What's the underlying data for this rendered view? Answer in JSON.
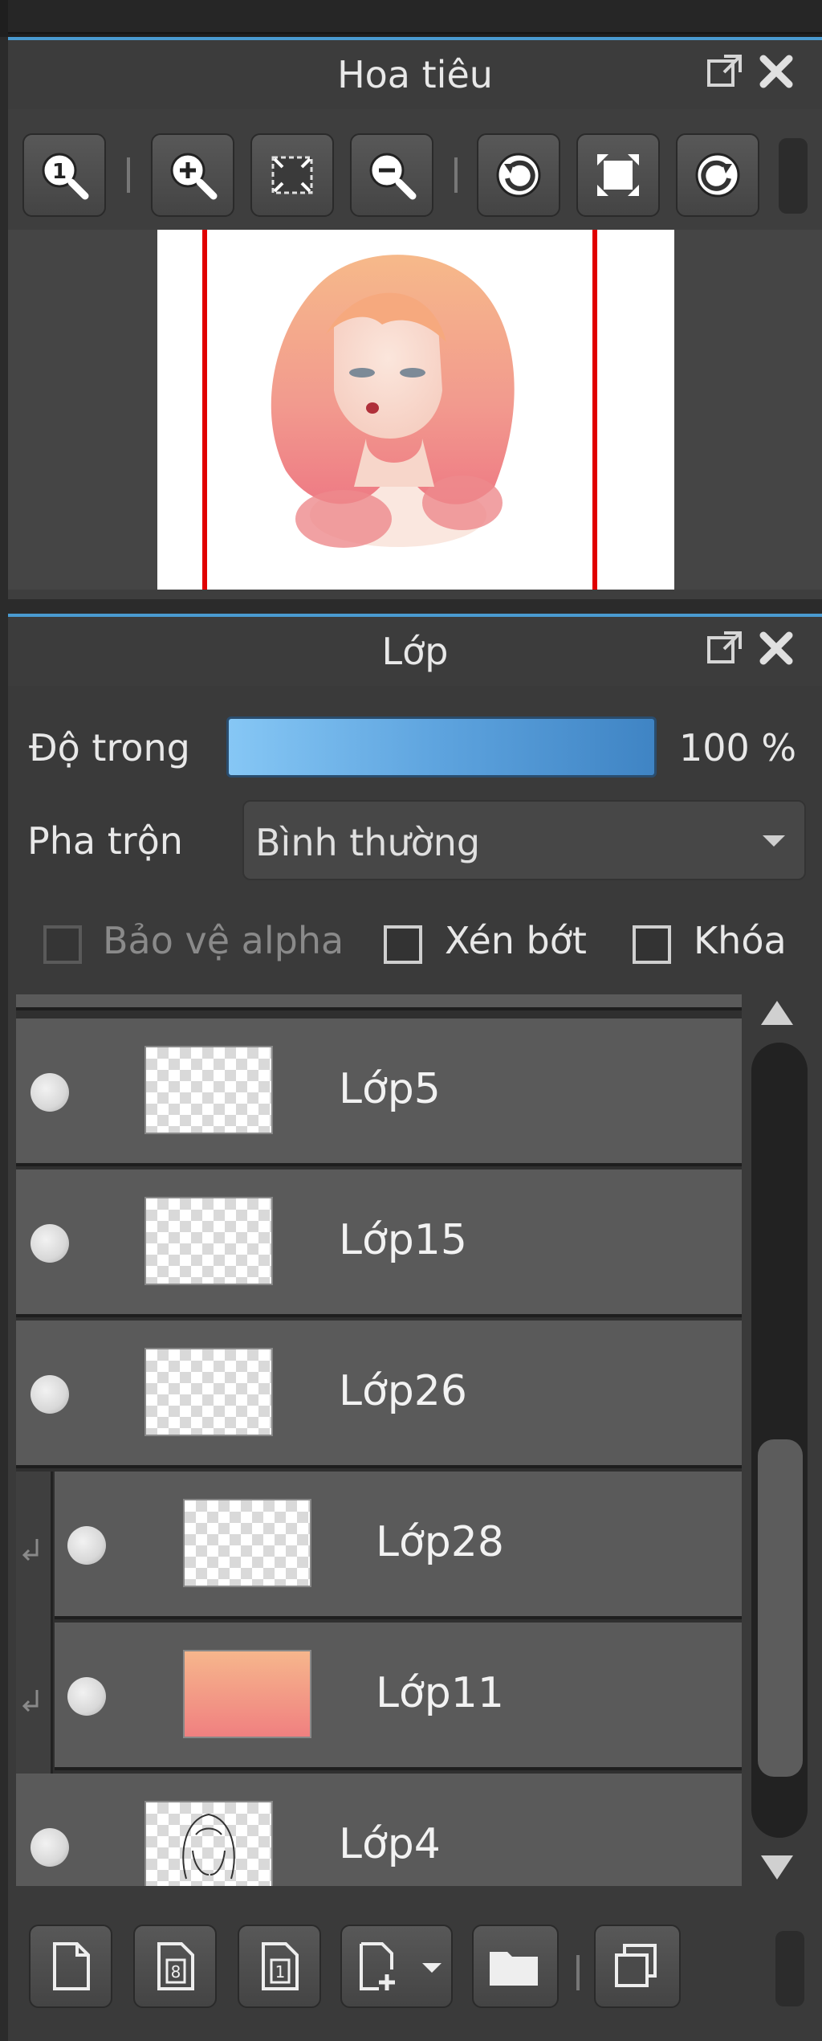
{
  "navigator": {
    "title": "Hoa tiêu",
    "tools": [
      {
        "icon": "actual-size-icon"
      },
      {
        "icon": "zoom-in-icon"
      },
      {
        "icon": "fit-screen-icon"
      },
      {
        "icon": "zoom-out-icon"
      },
      {
        "icon": "rotate-left-icon"
      },
      {
        "icon": "reset-view-icon"
      },
      {
        "icon": "rotate-right-icon"
      }
    ]
  },
  "layers_panel": {
    "title": "Lớp",
    "opacity_label": "Độ trong",
    "opacity_value": "100 %",
    "opacity_fraction": 1.0,
    "blend_label": "Pha trộn",
    "blend_value": "Bình thường",
    "protect_alpha": "Bảo vệ alpha",
    "clipping": "Xén bớt",
    "lock": "Khóa",
    "layers": [
      {
        "name": "Lớp5",
        "clipped": false,
        "thumb": "transparent"
      },
      {
        "name": "Lớp15",
        "clipped": false,
        "thumb": "transparent"
      },
      {
        "name": "Lớp26",
        "clipped": false,
        "thumb": "transparent"
      },
      {
        "name": "Lớp28",
        "clipped": true,
        "thumb": "transparent"
      },
      {
        "name": "Lớp11",
        "clipped": true,
        "thumb": "gradient"
      },
      {
        "name": "Lớp4",
        "clipped": false,
        "thumb": "sketch"
      }
    ],
    "bottom_tools": [
      {
        "icon": "new-layer-icon"
      },
      {
        "icon": "new-8bit-layer-icon"
      },
      {
        "icon": "new-1bit-layer-icon"
      },
      {
        "icon": "add-special-layer-icon"
      },
      {
        "icon": "new-folder-icon"
      },
      {
        "icon": "duplicate-layer-icon"
      }
    ]
  },
  "colors": {
    "accent": "#4a9bd1",
    "opacity_start": "#86c7f5",
    "opacity_end": "#3f84c4",
    "canvas_guide": "#e00000"
  }
}
